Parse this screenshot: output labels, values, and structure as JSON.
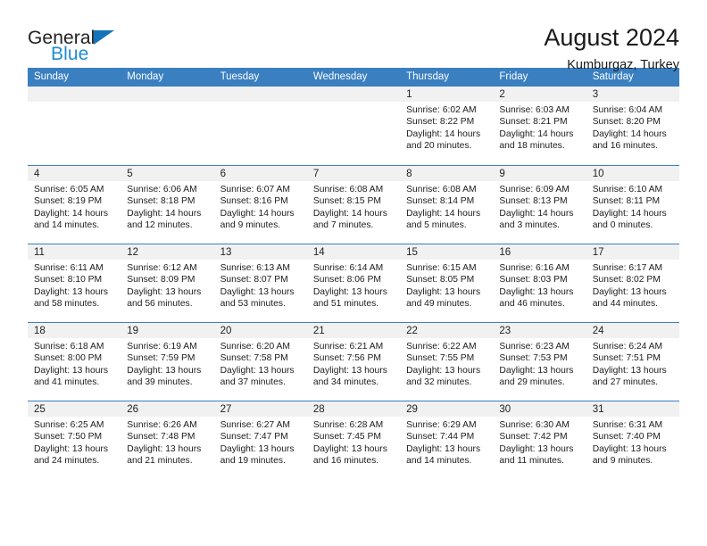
{
  "logo": {
    "word_top": "General",
    "word_bottom": "Blue",
    "triangle_icon": "triangle-icon",
    "accent_color": "#1f8ad2"
  },
  "header": {
    "title": "August 2024",
    "subtitle": "Kumburgaz, Turkey"
  },
  "theme": {
    "header_blue": "#3a7fc0",
    "daynum_band": "#f1f1f1"
  },
  "weekdays": [
    "Sunday",
    "Monday",
    "Tuesday",
    "Wednesday",
    "Thursday",
    "Friday",
    "Saturday"
  ],
  "weeks": [
    [
      {
        "day": "",
        "lines": []
      },
      {
        "day": "",
        "lines": []
      },
      {
        "day": "",
        "lines": []
      },
      {
        "day": "",
        "lines": []
      },
      {
        "day": "1",
        "lines": [
          "Sunrise: 6:02 AM",
          "Sunset: 8:22 PM",
          "Daylight: 14 hours",
          "and 20 minutes."
        ]
      },
      {
        "day": "2",
        "lines": [
          "Sunrise: 6:03 AM",
          "Sunset: 8:21 PM",
          "Daylight: 14 hours",
          "and 18 minutes."
        ]
      },
      {
        "day": "3",
        "lines": [
          "Sunrise: 6:04 AM",
          "Sunset: 8:20 PM",
          "Daylight: 14 hours",
          "and 16 minutes."
        ]
      }
    ],
    [
      {
        "day": "4",
        "lines": [
          "Sunrise: 6:05 AM",
          "Sunset: 8:19 PM",
          "Daylight: 14 hours",
          "and 14 minutes."
        ]
      },
      {
        "day": "5",
        "lines": [
          "Sunrise: 6:06 AM",
          "Sunset: 8:18 PM",
          "Daylight: 14 hours",
          "and 12 minutes."
        ]
      },
      {
        "day": "6",
        "lines": [
          "Sunrise: 6:07 AM",
          "Sunset: 8:16 PM",
          "Daylight: 14 hours",
          "and 9 minutes."
        ]
      },
      {
        "day": "7",
        "lines": [
          "Sunrise: 6:08 AM",
          "Sunset: 8:15 PM",
          "Daylight: 14 hours",
          "and 7 minutes."
        ]
      },
      {
        "day": "8",
        "lines": [
          "Sunrise: 6:08 AM",
          "Sunset: 8:14 PM",
          "Daylight: 14 hours",
          "and 5 minutes."
        ]
      },
      {
        "day": "9",
        "lines": [
          "Sunrise: 6:09 AM",
          "Sunset: 8:13 PM",
          "Daylight: 14 hours",
          "and 3 minutes."
        ]
      },
      {
        "day": "10",
        "lines": [
          "Sunrise: 6:10 AM",
          "Sunset: 8:11 PM",
          "Daylight: 14 hours",
          "and 0 minutes."
        ]
      }
    ],
    [
      {
        "day": "11",
        "lines": [
          "Sunrise: 6:11 AM",
          "Sunset: 8:10 PM",
          "Daylight: 13 hours",
          "and 58 minutes."
        ]
      },
      {
        "day": "12",
        "lines": [
          "Sunrise: 6:12 AM",
          "Sunset: 8:09 PM",
          "Daylight: 13 hours",
          "and 56 minutes."
        ]
      },
      {
        "day": "13",
        "lines": [
          "Sunrise: 6:13 AM",
          "Sunset: 8:07 PM",
          "Daylight: 13 hours",
          "and 53 minutes."
        ]
      },
      {
        "day": "14",
        "lines": [
          "Sunrise: 6:14 AM",
          "Sunset: 8:06 PM",
          "Daylight: 13 hours",
          "and 51 minutes."
        ]
      },
      {
        "day": "15",
        "lines": [
          "Sunrise: 6:15 AM",
          "Sunset: 8:05 PM",
          "Daylight: 13 hours",
          "and 49 minutes."
        ]
      },
      {
        "day": "16",
        "lines": [
          "Sunrise: 6:16 AM",
          "Sunset: 8:03 PM",
          "Daylight: 13 hours",
          "and 46 minutes."
        ]
      },
      {
        "day": "17",
        "lines": [
          "Sunrise: 6:17 AM",
          "Sunset: 8:02 PM",
          "Daylight: 13 hours",
          "and 44 minutes."
        ]
      }
    ],
    [
      {
        "day": "18",
        "lines": [
          "Sunrise: 6:18 AM",
          "Sunset: 8:00 PM",
          "Daylight: 13 hours",
          "and 41 minutes."
        ]
      },
      {
        "day": "19",
        "lines": [
          "Sunrise: 6:19 AM",
          "Sunset: 7:59 PM",
          "Daylight: 13 hours",
          "and 39 minutes."
        ]
      },
      {
        "day": "20",
        "lines": [
          "Sunrise: 6:20 AM",
          "Sunset: 7:58 PM",
          "Daylight: 13 hours",
          "and 37 minutes."
        ]
      },
      {
        "day": "21",
        "lines": [
          "Sunrise: 6:21 AM",
          "Sunset: 7:56 PM",
          "Daylight: 13 hours",
          "and 34 minutes."
        ]
      },
      {
        "day": "22",
        "lines": [
          "Sunrise: 6:22 AM",
          "Sunset: 7:55 PM",
          "Daylight: 13 hours",
          "and 32 minutes."
        ]
      },
      {
        "day": "23",
        "lines": [
          "Sunrise: 6:23 AM",
          "Sunset: 7:53 PM",
          "Daylight: 13 hours",
          "and 29 minutes."
        ]
      },
      {
        "day": "24",
        "lines": [
          "Sunrise: 6:24 AM",
          "Sunset: 7:51 PM",
          "Daylight: 13 hours",
          "and 27 minutes."
        ]
      }
    ],
    [
      {
        "day": "25",
        "lines": [
          "Sunrise: 6:25 AM",
          "Sunset: 7:50 PM",
          "Daylight: 13 hours",
          "and 24 minutes."
        ]
      },
      {
        "day": "26",
        "lines": [
          "Sunrise: 6:26 AM",
          "Sunset: 7:48 PM",
          "Daylight: 13 hours",
          "and 21 minutes."
        ]
      },
      {
        "day": "27",
        "lines": [
          "Sunrise: 6:27 AM",
          "Sunset: 7:47 PM",
          "Daylight: 13 hours",
          "and 19 minutes."
        ]
      },
      {
        "day": "28",
        "lines": [
          "Sunrise: 6:28 AM",
          "Sunset: 7:45 PM",
          "Daylight: 13 hours",
          "and 16 minutes."
        ]
      },
      {
        "day": "29",
        "lines": [
          "Sunrise: 6:29 AM",
          "Sunset: 7:44 PM",
          "Daylight: 13 hours",
          "and 14 minutes."
        ]
      },
      {
        "day": "30",
        "lines": [
          "Sunrise: 6:30 AM",
          "Sunset: 7:42 PM",
          "Daylight: 13 hours",
          "and 11 minutes."
        ]
      },
      {
        "day": "31",
        "lines": [
          "Sunrise: 6:31 AM",
          "Sunset: 7:40 PM",
          "Daylight: 13 hours",
          "and 9 minutes."
        ]
      }
    ]
  ]
}
